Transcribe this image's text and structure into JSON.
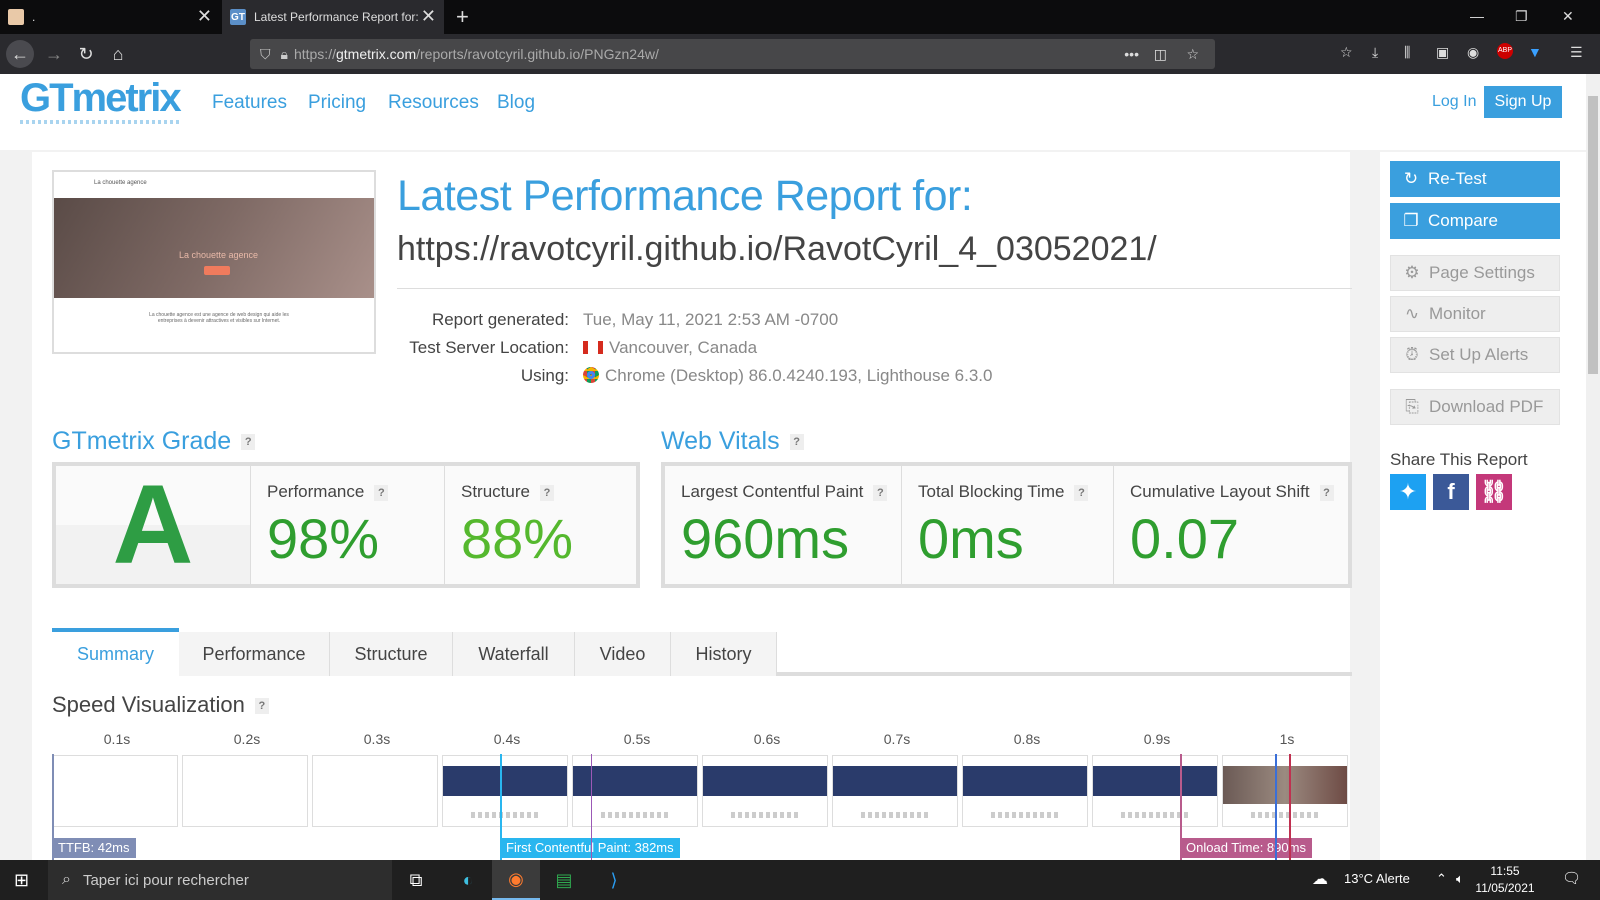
{
  "browser": {
    "tabs": [
      {
        "label": ".",
        "close": "✕"
      },
      {
        "label": "Latest Performance Report for:",
        "close": "✕",
        "favicon": "GT"
      }
    ],
    "new_tab": "+",
    "window_controls": {
      "minimize": "—",
      "restore": "❐",
      "close": "✕"
    },
    "url_prefix": "https://",
    "url_host": "gtmetrix.com",
    "url_path": "/reports/ravotcyril.github.io/PNGzn24w/",
    "url_more": "•••"
  },
  "site": {
    "logo": "GTmetrix",
    "nav": [
      "Features",
      "Pricing",
      "Resources",
      "Blog"
    ],
    "login": "Log In",
    "signup": "Sign Up"
  },
  "report": {
    "title": "Latest Performance Report for:",
    "url": "https://ravotcyril.github.io/RavotCyril_4_03052021/",
    "meta": [
      {
        "label": "Report generated:",
        "value": "Tue, May 11, 2021 2:53 AM -0700"
      },
      {
        "label": "Test Server Location:",
        "value": "Vancouver, Canada"
      },
      {
        "label": "Using:",
        "value": "Chrome (Desktop) 86.0.4240.193, Lighthouse 6.3.0"
      }
    ],
    "thumb_text": {
      "header": "La chouette agence",
      "hero": "La chouette agence",
      "body": "La chouette agence est une agence de web design qui aide les entreprises à devenir attractives et visibles sur Internet."
    }
  },
  "grade": {
    "title": "GTmetrix Grade",
    "letter": "A",
    "metrics": [
      {
        "label": "Performance",
        "value": "98%"
      },
      {
        "label": "Structure",
        "value": "88%"
      }
    ]
  },
  "vitals": {
    "title": "Web Vitals",
    "metrics": [
      {
        "label": "Largest Contentful Paint",
        "value": "960ms"
      },
      {
        "label": "Total Blocking Time",
        "value": "0ms"
      },
      {
        "label": "Cumulative Layout Shift",
        "value": "0.07"
      }
    ]
  },
  "help_mark": "?",
  "tabs": [
    "Summary",
    "Performance",
    "Structure",
    "Waterfall",
    "Video",
    "History"
  ],
  "speed": {
    "title": "Speed Visualization",
    "ticks": [
      "0.1s",
      "0.2s",
      "0.3s",
      "0.4s",
      "0.5s",
      "0.6s",
      "0.7s",
      "0.8s",
      "0.9s",
      "1s"
    ],
    "markers": [
      {
        "label": "TTFB: 42ms",
        "color": "#7f8db5"
      },
      {
        "label": "First Contentful Paint: 382ms",
        "color": "#29b6ef"
      },
      {
        "label": "Onload Time: 890ms",
        "color": "#b85b8c"
      }
    ]
  },
  "sidebar": {
    "buttons": [
      {
        "label": "Re-Test",
        "icon": "refresh-icon"
      },
      {
        "label": "Compare",
        "icon": "compare-icon"
      },
      {
        "label": "Page Settings",
        "icon": "gear-icon"
      },
      {
        "label": "Monitor",
        "icon": "pulse-icon"
      },
      {
        "label": "Set Up Alerts",
        "icon": "alarm-icon"
      },
      {
        "label": "Download PDF",
        "icon": "pdf-icon"
      }
    ],
    "share_title": "Share This Report"
  },
  "taskbar": {
    "search_placeholder": "Taper ici pour rechercher",
    "weather": "13°C  Alerte",
    "time": "11:55",
    "date": "11/05/2021"
  },
  "colors": {
    "brand": "#3a9fde",
    "grade_green": "#2e9d44"
  }
}
